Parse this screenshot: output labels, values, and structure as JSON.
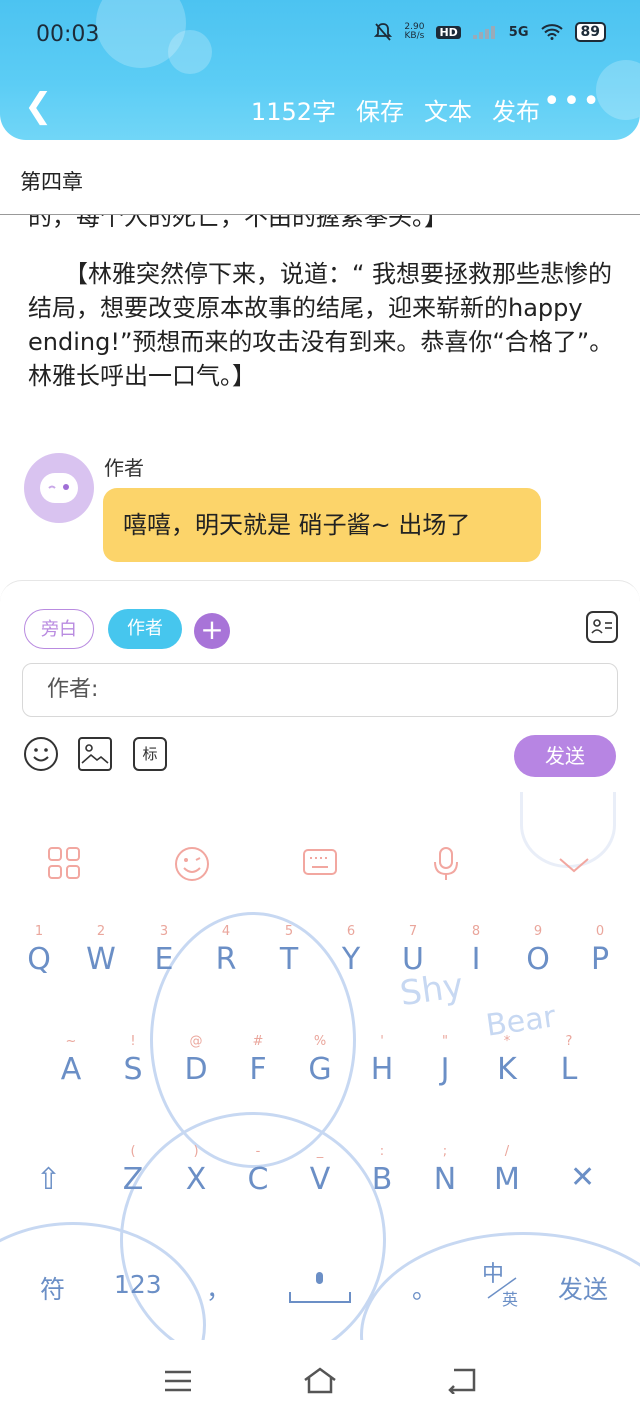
{
  "status": {
    "time": "00:03",
    "net_speed_value": "2.90",
    "net_speed_unit": "KB/s",
    "hd": "HD",
    "signal_label": "5G",
    "battery": "89"
  },
  "header": {
    "word_count": "1152字",
    "save": "保存",
    "text": "文本",
    "publish": "发布"
  },
  "chapter_title": "第四章",
  "content": {
    "cut_line": "的，每个人的死亡，不由的握紧拳头。】",
    "paragraph": "　　【林雅突然停下来，说道：“ 我想要拯救那些悲惨的结局，想要改变原本故事的结尾，迎来崭新的happy ending!”预想而来的攻击没有到来。恭喜你“合格了”。林雅长呼出一口气。】",
    "author_label": "作者",
    "message": "嘻嘻，明天就是 硝子酱~ 出场了"
  },
  "composer": {
    "chip_narration": "旁白",
    "chip_author": "作者",
    "input_value": "作者:",
    "tool_mark": "标",
    "send": "发送"
  },
  "keyboard": {
    "row1": [
      {
        "hint": "1",
        "key": "Q"
      },
      {
        "hint": "2",
        "key": "W"
      },
      {
        "hint": "3",
        "key": "E"
      },
      {
        "hint": "4",
        "key": "R"
      },
      {
        "hint": "5",
        "key": "T"
      },
      {
        "hint": "6",
        "key": "Y"
      },
      {
        "hint": "7",
        "key": "U"
      },
      {
        "hint": "8",
        "key": "I"
      },
      {
        "hint": "9",
        "key": "O"
      },
      {
        "hint": "0",
        "key": "P"
      }
    ],
    "row2": [
      {
        "hint": "~",
        "key": "A"
      },
      {
        "hint": "!",
        "key": "S"
      },
      {
        "hint": "@",
        "key": "D"
      },
      {
        "hint": "#",
        "key": "F"
      },
      {
        "hint": "%",
        "key": "G"
      },
      {
        "hint": "'",
        "key": "H"
      },
      {
        "hint": "\"",
        "key": "J"
      },
      {
        "hint": "*",
        "key": "K"
      },
      {
        "hint": "?",
        "key": "L"
      }
    ],
    "row3": [
      {
        "hint": "(",
        "key": "Z"
      },
      {
        "hint": ")",
        "key": "X"
      },
      {
        "hint": "-",
        "key": "C"
      },
      {
        "hint": "_",
        "key": "V"
      },
      {
        "hint": ":",
        "key": "B"
      },
      {
        "hint": ";",
        "key": "N"
      },
      {
        "hint": "/",
        "key": "M"
      }
    ],
    "symbols": "符",
    "numbers": "123",
    "comma": "，",
    "period": "。",
    "lang_zh": "中",
    "lang_en": "英",
    "send": "发送",
    "delete": "✕",
    "shift": "⇧",
    "deco_shy": "Shy",
    "deco_bear": "Bear"
  },
  "colors": {
    "header": "#4cc3f1",
    "message_bubble": "#fcd46a",
    "accent_purple": "#b785e3",
    "chip_blue": "#46c6ee",
    "key_text": "#6b8fc6",
    "key_hint": "#eaa69c"
  },
  "icons": {
    "back": "chevron-left-icon",
    "more": "more-horizontal-icon",
    "contact": "contact-card-icon",
    "emoji": "emoji-icon",
    "image": "image-icon",
    "grid": "grid-icon",
    "keyboard": "keyboard-icon",
    "mic": "mic-icon"
  }
}
